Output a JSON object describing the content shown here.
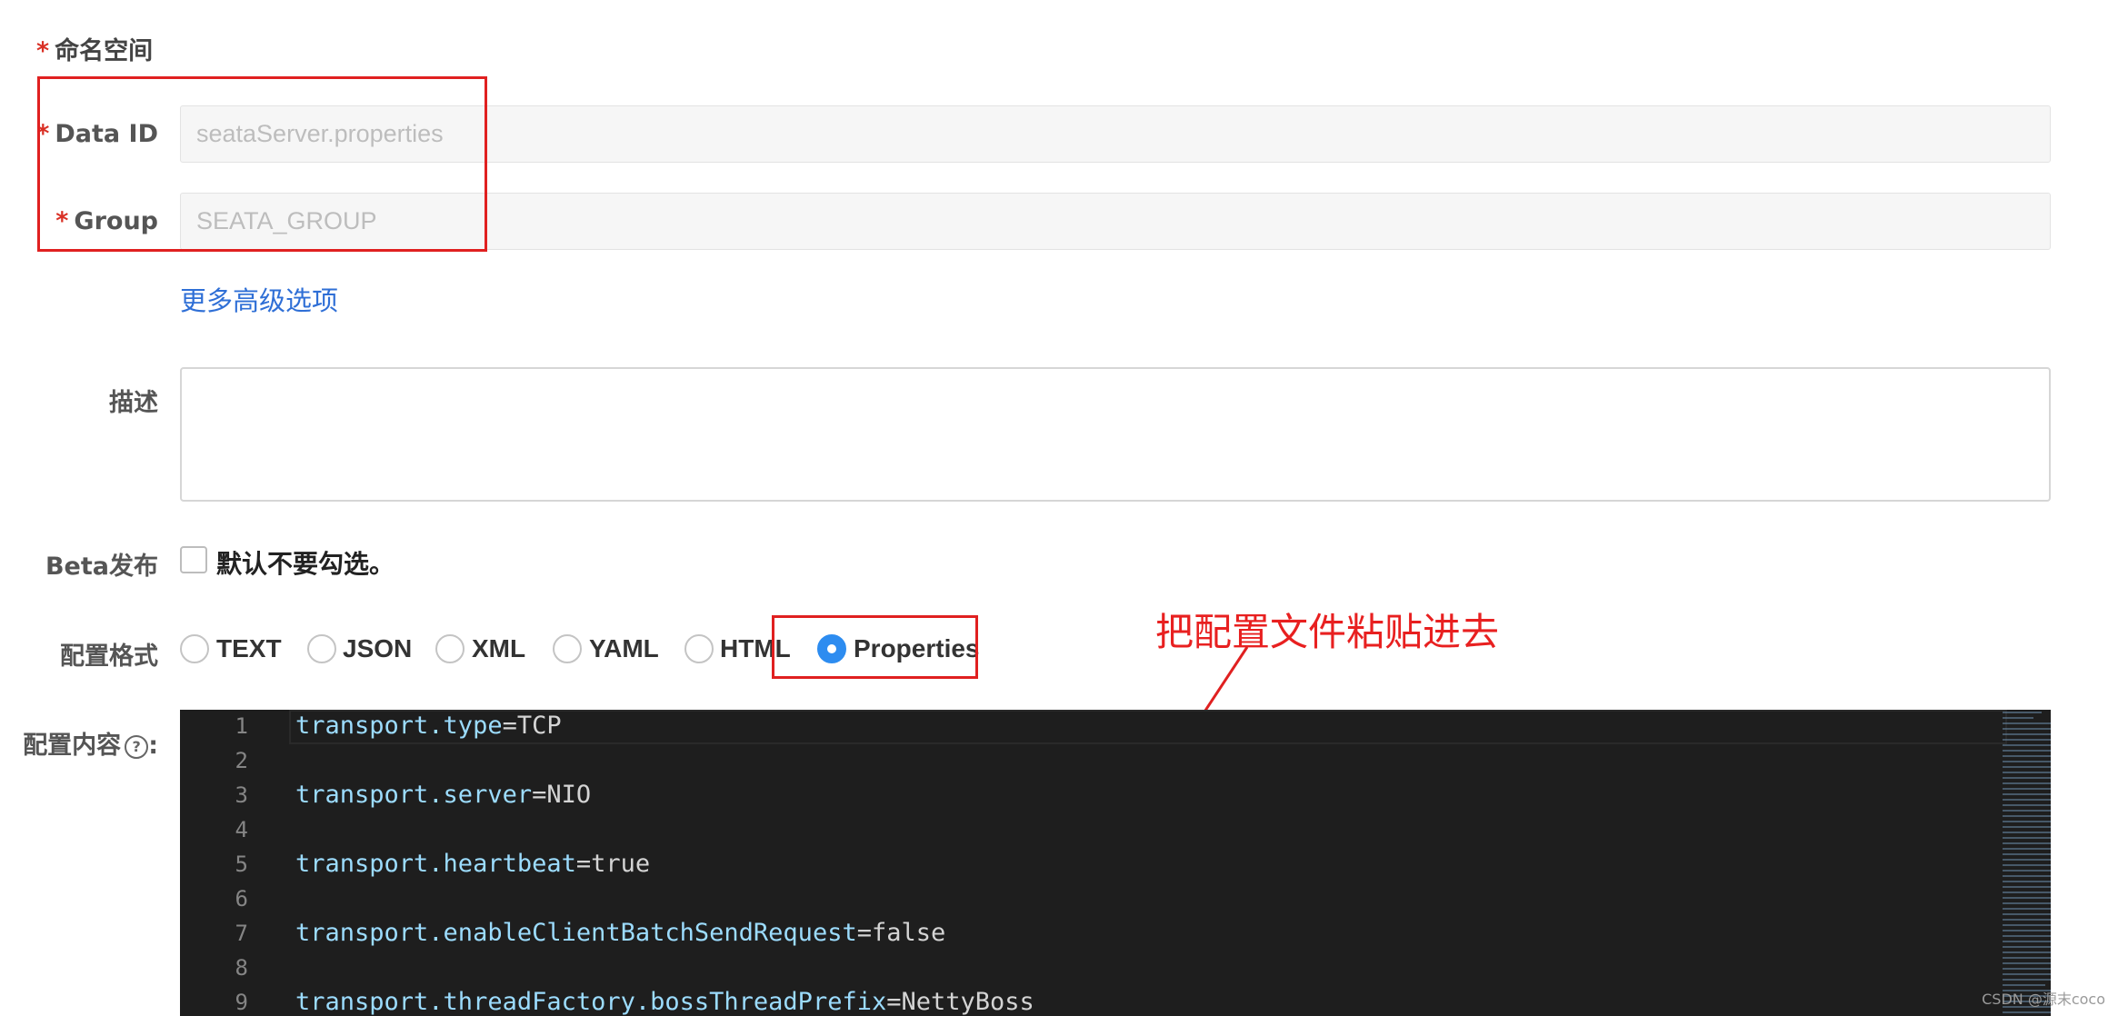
{
  "form": {
    "namespace_label": "命名空间",
    "data_id": {
      "label": "Data ID",
      "value": "seataServer.properties"
    },
    "group": {
      "label": "Group",
      "value": "SEATA_GROUP"
    },
    "advanced_link": "更多高级选项",
    "description": {
      "label": "描述",
      "value": ""
    },
    "beta": {
      "label": "Beta发布",
      "checkbox_text": "默认不要勾选。",
      "checked": false
    },
    "format": {
      "label": "配置格式",
      "options": [
        "TEXT",
        "JSON",
        "XML",
        "YAML",
        "HTML",
        "Properties"
      ],
      "selected": "Properties"
    },
    "content": {
      "label": "配置内容",
      "help_icon": "question-circle-icon",
      "colon": ":"
    }
  },
  "annotation": {
    "text": "把配置文件粘贴进去",
    "color": "#e82020"
  },
  "editor": {
    "lines": [
      {
        "num": "1",
        "key": "transport.type",
        "value": "TCP"
      },
      {
        "num": "2",
        "key": "",
        "value": ""
      },
      {
        "num": "3",
        "key": "transport.server",
        "value": "NIO"
      },
      {
        "num": "4",
        "key": "",
        "value": ""
      },
      {
        "num": "5",
        "key": "transport.heartbeat",
        "value": "true"
      },
      {
        "num": "6",
        "key": "",
        "value": ""
      },
      {
        "num": "7",
        "key": "transport.enableClientBatchSendRequest",
        "value": "false"
      },
      {
        "num": "8",
        "key": "",
        "value": ""
      },
      {
        "num": "9",
        "key": "transport.threadFactory.bossThreadPrefix",
        "value": "NettyBoss"
      }
    ]
  },
  "colors": {
    "accent": "#2d8cf0",
    "link": "#2f6fd6",
    "required": "#d93025",
    "editor_bg": "#1e1e1e"
  },
  "watermark": "CSDN @源末coco"
}
